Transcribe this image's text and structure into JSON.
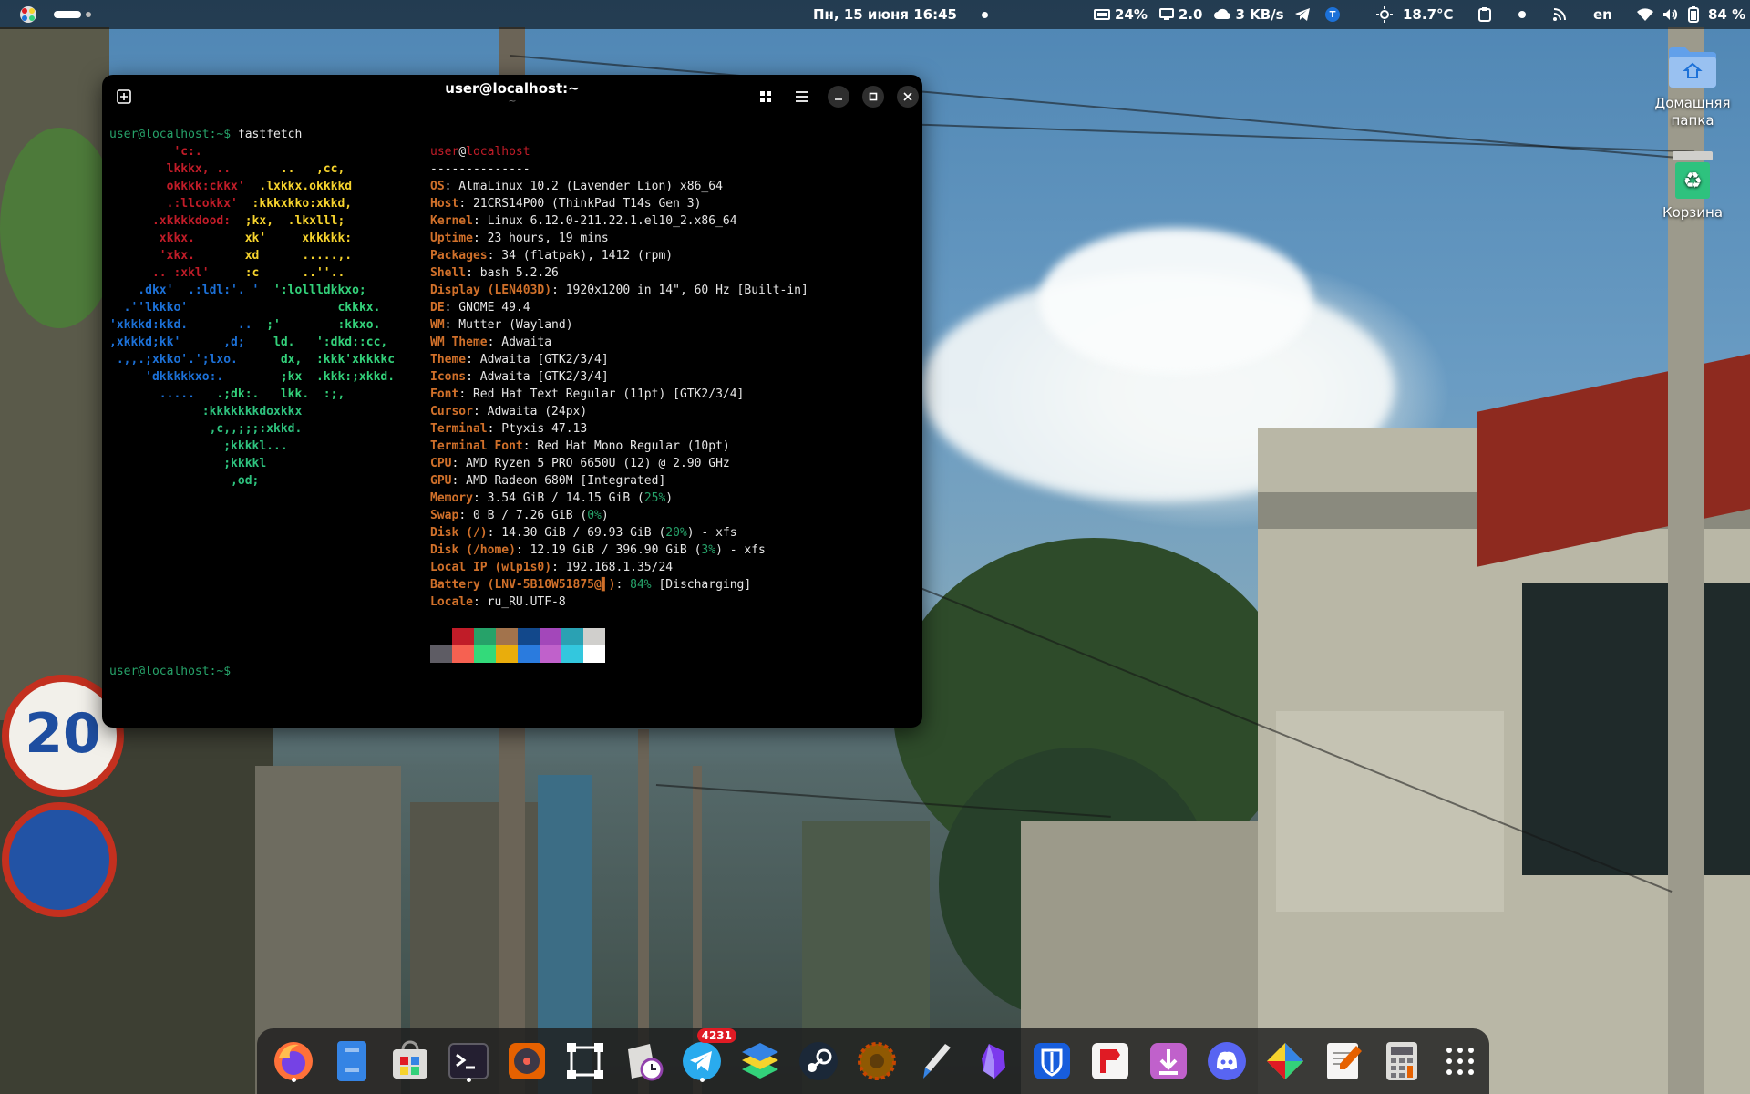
{
  "topbar": {
    "datetime": "Пн, 15 июня  16:45",
    "cpu": "24%",
    "load": "2.0",
    "net": "3 KB/s",
    "weather": "18.7°C",
    "keyboard": "en",
    "battery": "84 %"
  },
  "desktop": {
    "home_label": "Домашняя папка",
    "trash_label": "Корзина"
  },
  "terminal": {
    "title": "user@localhost:~",
    "subtitle": "~",
    "prompt": "user@localhost:~$",
    "command": " fastfetch",
    "user": "user",
    "host": "localhost",
    "separator": "--------------",
    "info": [
      {
        "label": "OS",
        "value": ": AlmaLinux 10.2 (Lavender Lion) x86_64"
      },
      {
        "label": "Host",
        "value": ": 21CRS14P00 (ThinkPad T14s Gen 3)"
      },
      {
        "label": "Kernel",
        "value": ": Linux 6.12.0-211.22.1.el10_2.x86_64"
      },
      {
        "label": "Uptime",
        "value": ": 23 hours, 19 mins"
      },
      {
        "label": "Packages",
        "value": ": 34 (flatpak), 1412 (rpm)"
      },
      {
        "label": "Shell",
        "value": ": bash 5.2.26"
      },
      {
        "label": "Display (LEN403D)",
        "value": ": 1920x1200 in 14\", 60 Hz [Built-in]"
      },
      {
        "label": "DE",
        "value": ": GNOME 49.4"
      },
      {
        "label": "WM",
        "value": ": Mutter (Wayland)"
      },
      {
        "label": "WM Theme",
        "value": ": Adwaita"
      },
      {
        "label": "Theme",
        "value": ": Adwaita [GTK2/3/4]"
      },
      {
        "label": "Icons",
        "value": ": Adwaita [GTK2/3/4]"
      },
      {
        "label": "Font",
        "value": ": Red Hat Text Regular (11pt) [GTK2/3/4]"
      },
      {
        "label": "Cursor",
        "value": ": Adwaita (24px)"
      },
      {
        "label": "Terminal",
        "value": ": Ptyxis 47.13"
      },
      {
        "label": "Terminal Font",
        "value": ": Red Hat Mono Regular (10pt)"
      },
      {
        "label": "CPU",
        "value": ": AMD Ryzen 5 PRO 6650U (12) @ 2.90 GHz"
      },
      {
        "label": "GPU",
        "value": ": AMD Radeon 680M [Integrated]"
      },
      {
        "label": "Memory",
        "value": ": 3.54 GiB / 14.15 GiB (",
        "pct": "25%",
        "tail": ")"
      },
      {
        "label": "Swap",
        "value": ": 0 B / 7.26 GiB (",
        "pct": "0%",
        "tail": ")"
      },
      {
        "label": "Disk (/)",
        "value": ": 14.30 GiB / 69.93 GiB (",
        "pct": "20%",
        "tail": ") - xfs"
      },
      {
        "label": "Disk (/home)",
        "value": ": 12.19 GiB / 396.90 GiB (",
        "pct": "3%",
        "tail": ") - xfs"
      },
      {
        "label": "Local IP (wlp1s0)",
        "value": ": 192.168.1.35/24"
      },
      {
        "label": "Battery (LNV-5B10W51875@▌)",
        "value": ": ",
        "pct": "84%",
        "tail": " [Discharging]"
      },
      {
        "label": "Locale",
        "value": ": ru_RU.UTF-8"
      }
    ],
    "logo": [
      {
        "text": "         'c:.",
        "color": "#c01c28"
      },
      {
        "text": "        lkkkx, ..       ..   ,cc,",
        "color": "#c01c28",
        "tail_color": "#f6d32d",
        "split": 24
      },
      {
        "text": "        okkkk:ckkx'  .lxkkx.okkkkd",
        "color": "#c01c28",
        "tail_color": "#f6d32d",
        "split": 21
      },
      {
        "text": "        .:llcokkx'  :kkkxkko:xkkd,",
        "color": "#c01c28",
        "tail_color": "#f6d32d",
        "split": 20
      },
      {
        "text": "      .xkkkkdood:  ;kx,  .lkxlll;",
        "color": "#c01c28",
        "tail_color": "#f6d32d",
        "split": 18
      },
      {
        "text": "       xkkx.       xk'     xkkkkk:",
        "color": "#c01c28",
        "tail_color": "#f6d32d",
        "split": 18
      },
      {
        "text": "       'xkx.       xd      .....,.",
        "color": "#c01c28",
        "tail_color": "#f6d32d",
        "split": 18
      },
      {
        "text": "      .. :xkl'     :c      ..''..",
        "color": "#c01c28",
        "tail_color": "#f6d32d",
        "split": 18
      },
      {
        "text": "    .dkx'  .:ldl:'. '  ':lollldkkxo;",
        "color": "#1c71d8",
        "tail_color": "#33d17a",
        "split": 22
      },
      {
        "text": "  .''lkkko'                     ckkkx.",
        "color": "#1c71d8",
        "tail_color": "#33d17a",
        "split": 30
      },
      {
        "text": "'xkkkd:kkd.       ..  ;'        :kkxo.",
        "color": "#1c71d8",
        "tail_color": "#33d17a",
        "split": 22
      },
      {
        "text": ",xkkkd;kk'      ,d;    ld.   ':dkd::cc,",
        "color": "#1c71d8",
        "tail_color": "#33d17a",
        "split": 22
      },
      {
        "text": " .,,.;xkko'.';lxo.      dx,  :kkk'xkkkkc",
        "color": "#1c71d8",
        "tail_color": "#33d17a",
        "split": 22
      },
      {
        "text": "     'dkkkkkxo:.        ;kx  .kkk:;xkkd.",
        "color": "#1c71d8",
        "tail_color": "#33d17a",
        "split": 22
      },
      {
        "text": "       .....   .;dk:.   lkk.  :;,",
        "color": "#1c71d8",
        "tail_color": "#33d17a",
        "split": 14
      },
      {
        "text": "             :kkkkkkkdoxkkx",
        "color": "#2ec27e"
      },
      {
        "text": "              ,c,,;;;:xkkd.",
        "color": "#2ec27e"
      },
      {
        "text": "                ;kkkkl...",
        "color": "#2ec27e"
      },
      {
        "text": "                ;kkkkl",
        "color": "#2ec27e"
      },
      {
        "text": "                 ,od;",
        "color": "#2ec27e"
      }
    ],
    "palette_top": [
      "#000000",
      "#c01c28",
      "#26a269",
      "#a2734c",
      "#12488b",
      "#a347ba",
      "#2aa1b3",
      "#d0cfcc"
    ],
    "palette_bottom": [
      "#5e5c64",
      "#f66151",
      "#33da7a",
      "#e9ad0c",
      "#2a7bde",
      "#c061cb",
      "#33c7de",
      "#ffffff"
    ]
  },
  "dock": {
    "telegram_badge": "4231",
    "apps": [
      "firefox-icon",
      "files-icon",
      "software-icon",
      "terminal-icon",
      "rhythmbox-icon",
      "inkscape-icon",
      "clocks-icon",
      "telegram-icon",
      "layers-icon",
      "steam-icon",
      "gimp-icon",
      "krita-icon",
      "obsidian-icon",
      "bitwarden-icon",
      "flathub-icon",
      "downloader-icon",
      "discord-icon",
      "fragments-icon",
      "editor-icon",
      "calculator-icon",
      "app-grid-icon"
    ]
  }
}
